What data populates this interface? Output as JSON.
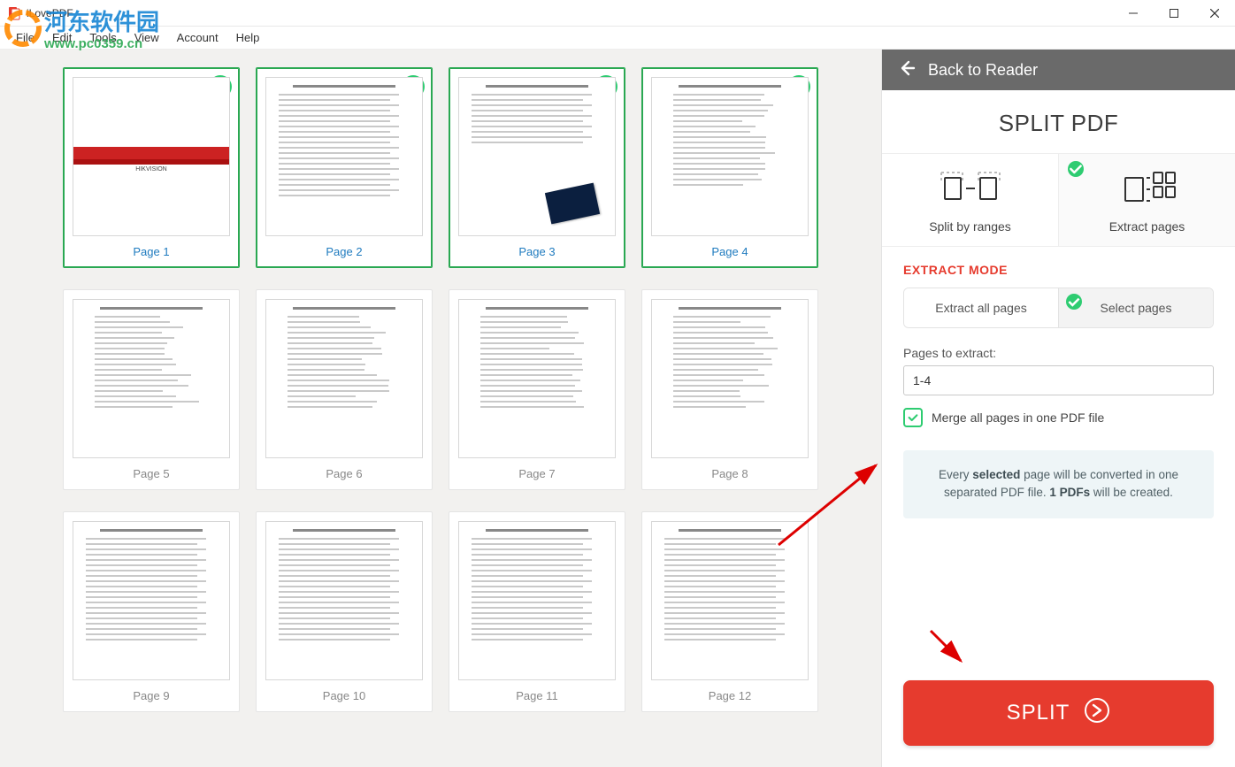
{
  "window": {
    "title": "iLovePDF"
  },
  "menu": {
    "items": [
      "File",
      "Edit",
      "Tools",
      "View",
      "Account",
      "Help"
    ]
  },
  "watermark": {
    "line1": "河东软件园",
    "line2": "www.pc0359.cn"
  },
  "pages": [
    {
      "label": "Page 1",
      "selected": true,
      "kind": "cover"
    },
    {
      "label": "Page 2",
      "selected": true,
      "kind": "text"
    },
    {
      "label": "Page 3",
      "selected": true,
      "kind": "table-photo"
    },
    {
      "label": "Page 4",
      "selected": true,
      "kind": "toc"
    },
    {
      "label": "Page 5",
      "selected": false,
      "kind": "toc"
    },
    {
      "label": "Page 6",
      "selected": false,
      "kind": "toc"
    },
    {
      "label": "Page 7",
      "selected": false,
      "kind": "toc"
    },
    {
      "label": "Page 8",
      "selected": false,
      "kind": "toc"
    },
    {
      "label": "Page 9",
      "selected": false,
      "kind": "text"
    },
    {
      "label": "Page 10",
      "selected": false,
      "kind": "text"
    },
    {
      "label": "Page 11",
      "selected": false,
      "kind": "text"
    },
    {
      "label": "Page 12",
      "selected": false,
      "kind": "text"
    }
  ],
  "panel": {
    "back_label": "Back to Reader",
    "title": "SPLIT PDF",
    "tabs": {
      "ranges_label": "Split by ranges",
      "extract_label": "Extract pages",
      "active": "extract"
    },
    "section_heading": "EXTRACT MODE",
    "extract_mode": {
      "all_label": "Extract all pages",
      "select_label": "Select pages",
      "active": "select"
    },
    "pages_field": {
      "label": "Pages to extract:",
      "value": "1-4"
    },
    "merge_checkbox": {
      "checked": true,
      "label": "Merge all pages in one PDF file"
    },
    "info": {
      "pre": "Every ",
      "bold1": "selected",
      "mid": " page will be converted in one separated PDF file. ",
      "bold2": "1 PDFs",
      "post": " will be created."
    },
    "action_label": "SPLIT"
  }
}
